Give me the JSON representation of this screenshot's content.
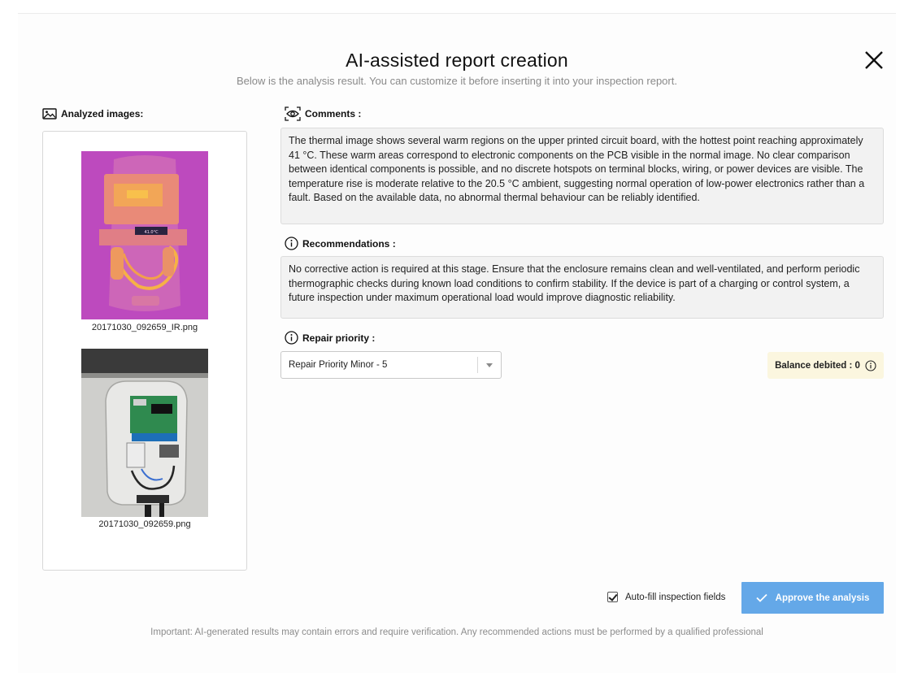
{
  "dialog": {
    "title": "AI-assisted report creation",
    "subtitle": "Below is the analysis result. You can customize it before inserting it into your inspection report.",
    "close_icon": "close-icon"
  },
  "images": {
    "heading": "Analyzed images:",
    "items": [
      {
        "filename": "20171030_092659_IR.png",
        "kind": "thermal"
      },
      {
        "filename": "20171030_092659.png",
        "kind": "visual"
      }
    ]
  },
  "comments": {
    "heading": "Comments :",
    "text": "The thermal image shows several warm regions on the upper printed circuit board, with the hottest point reaching approximately 41 °C. These warm areas correspond to electronic components on the PCB visible in the normal image. No clear comparison between identical components is possible, and no discrete hotspots on terminal blocks, wiring, or power devices are visible. The temperature rise is moderate relative to the 20.5 °C ambient, suggesting normal operation of low-power electronics rather than a fault. Based on the available data, no abnormal thermal behaviour can be reliably identified."
  },
  "recommendations": {
    "heading": "Recommendations :",
    "text": "No corrective action is required at this stage. Ensure that the enclosure remains clean and well-ventilated, and perform periodic thermographic checks during known load conditions to confirm stability. If the device is part of a charging or control system, a future inspection under maximum operational load would improve diagnostic reliability."
  },
  "repair_priority": {
    "heading": "Repair priority :",
    "selected": "Repair Priority Minor - 5"
  },
  "balance": {
    "label": "Balance debited : 0"
  },
  "actions": {
    "autofill_label": "Auto-fill inspection fields",
    "autofill_checked": true,
    "approve_label": "Approve the analysis"
  },
  "footer": {
    "note": "Important: AI-generated results may contain errors and require verification. Any recommended actions must be performed by a qualified professional"
  },
  "colors": {
    "accent": "#64a8e8",
    "balance_bg": "#fbf6df",
    "textbox_bg": "#f2f2f2",
    "thermal_bg": "#c14fc0"
  }
}
